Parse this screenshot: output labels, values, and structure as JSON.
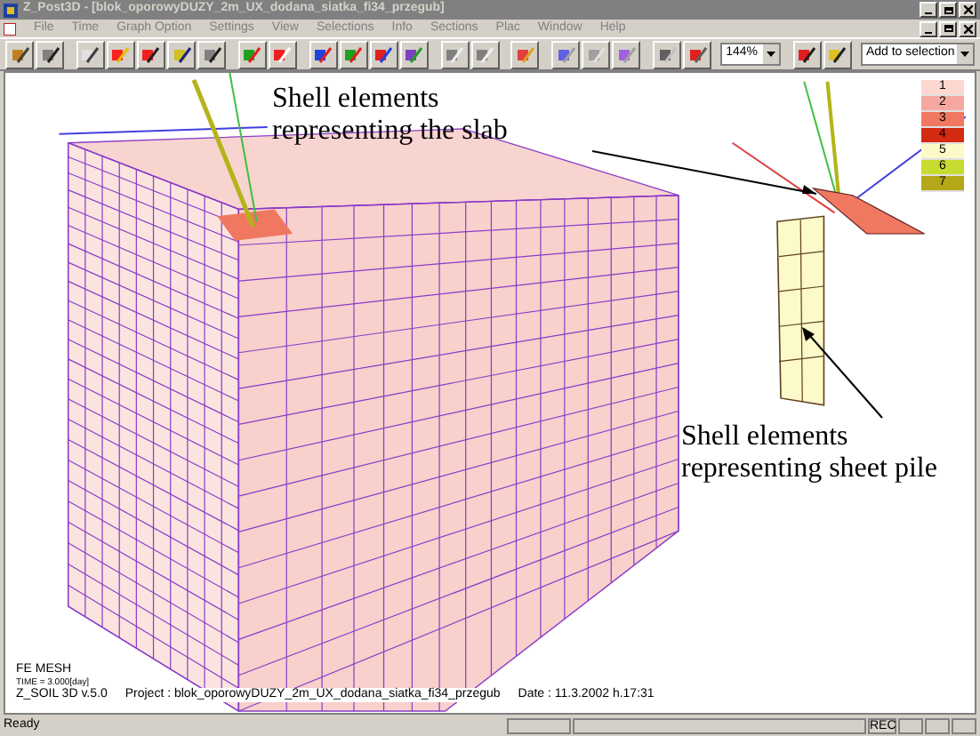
{
  "window": {
    "title": "Z_Post3D - [blok_oporowyDUZY_2m_UX_dodana_siatka_fi34_przegub]"
  },
  "menu": [
    "File",
    "Time",
    "Graph Option",
    "Settings",
    "View",
    "Selections",
    "Info",
    "Sections",
    "Plac",
    "Window",
    "Help"
  ],
  "toolbar": {
    "zoom": "144%",
    "selection_mode": "Add to selection"
  },
  "annotations": [
    {
      "lines": [
        "Shell elements",
        "representing the slab"
      ]
    },
    {
      "lines": [
        "Shell elements",
        "representing sheet pile"
      ]
    }
  ],
  "legend": [
    {
      "label": "1",
      "color": "#fcd8d0"
    },
    {
      "label": "2",
      "color": "#f6a8a0"
    },
    {
      "label": "3",
      "color": "#f07860"
    },
    {
      "label": "4",
      "color": "#d42a10"
    },
    {
      "label": "5",
      "color": "#fcfac8"
    },
    {
      "label": "6",
      "color": "#c8dc30"
    },
    {
      "label": "7",
      "color": "#b4a818"
    }
  ],
  "info": {
    "title": "FE MESH",
    "time": "TIME = 3.000[day]",
    "version": "Z_SOIL 3D v.5.0",
    "project": "Project : blok_oporowyDUZY_2m_UX_dodana_siatka_fi34_przegub",
    "date": "Date : 11.3.2002  h.17:31"
  },
  "status_bar": {
    "message": "Ready",
    "indicator": "REC"
  }
}
